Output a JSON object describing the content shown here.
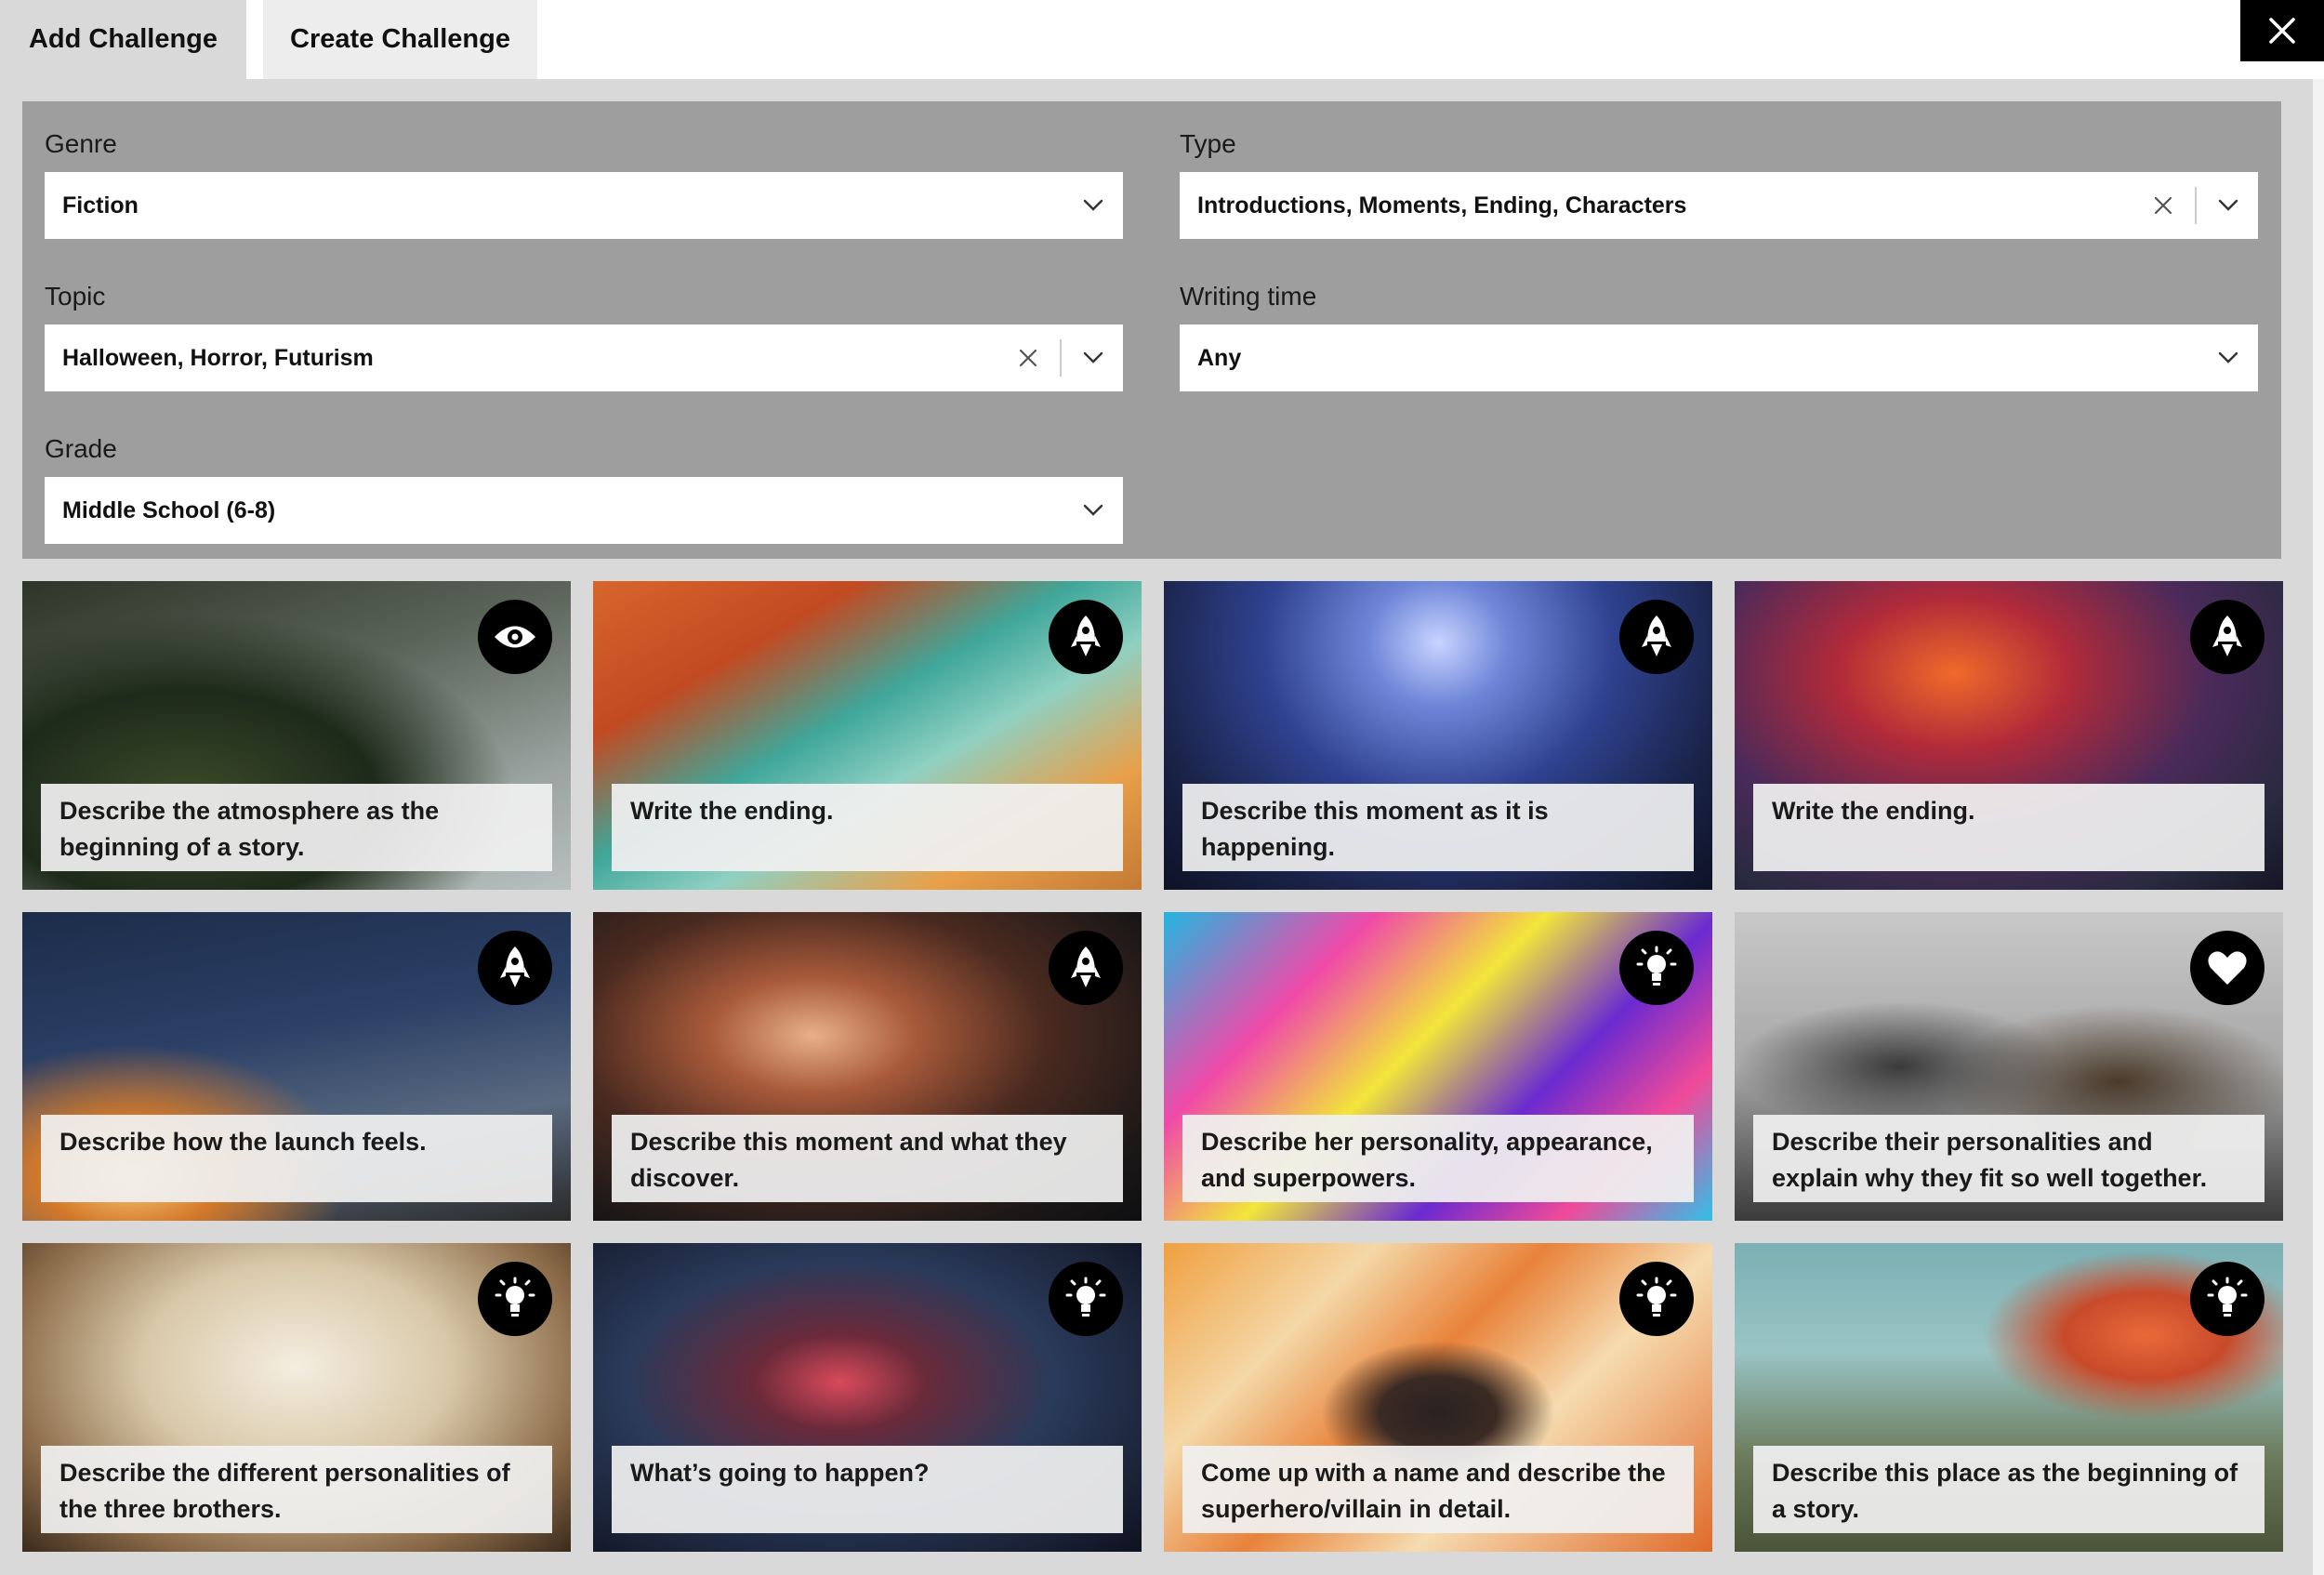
{
  "tabs": {
    "add": "Add Challenge",
    "create": "Create Challenge"
  },
  "filters": {
    "genre": {
      "label": "Genre",
      "value": "Fiction"
    },
    "type": {
      "label": "Type",
      "value": "Introductions, Moments, Ending, Characters"
    },
    "topic": {
      "label": "Topic",
      "value": "Halloween, Horror, Futurism"
    },
    "writing_time": {
      "label": "Writing time",
      "value": "Any"
    },
    "grade": {
      "label": "Grade",
      "value": "Middle School (6-8)"
    }
  },
  "cards": [
    {
      "caption": "Describe the atmosphere as the beginning of a story.",
      "icon": "eye-icon"
    },
    {
      "caption": "Write the ending.",
      "icon": "rocket-icon"
    },
    {
      "caption": "Describe this moment as it is happening.",
      "icon": "rocket-icon"
    },
    {
      "caption": "Write the ending.",
      "icon": "rocket-icon"
    },
    {
      "caption": "Describe how the launch feels.",
      "icon": "rocket-icon"
    },
    {
      "caption": "Describe this moment and what they discover.",
      "icon": "rocket-icon"
    },
    {
      "caption": "Describe her personality, appearance, and superpowers.",
      "icon": "lightbulb-icon"
    },
    {
      "caption": "Describe their personalities and explain why they fit so well together.",
      "icon": "heart-icon"
    },
    {
      "caption": "Describe the different personalities of the three brothers.",
      "icon": "lightbulb-icon"
    },
    {
      "caption": "What’s going to happen?",
      "icon": "lightbulb-icon"
    },
    {
      "caption": "Come up with a name and describe the superhero/villain in detail.",
      "icon": "lightbulb-icon"
    },
    {
      "caption": "Describe this place as the beginning of a story.",
      "icon": "lightbulb-icon"
    }
  ],
  "colors": {
    "panel": "#9e9e9e",
    "page": "#d9d9d9",
    "badge": "#000000"
  }
}
